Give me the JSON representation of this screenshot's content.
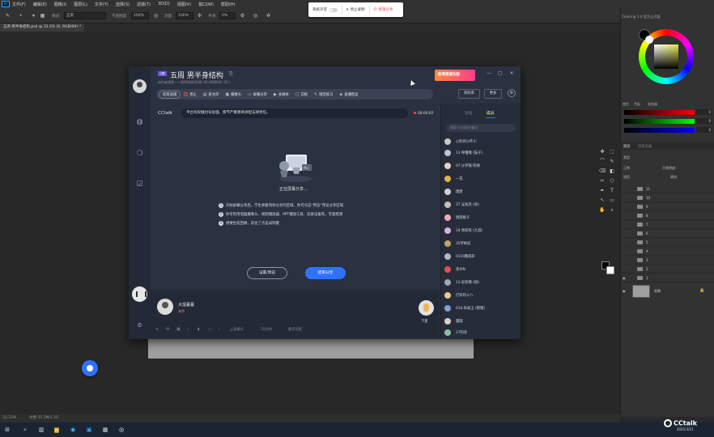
{
  "ps": {
    "menu": [
      "文件(F)",
      "编辑(E)",
      "图像(I)",
      "图层(L)",
      "文字(Y)",
      "选择(S)",
      "滤镜(T)",
      "3D(D)",
      "视图(V)",
      "窗口(W)",
      "帮助(H)"
    ],
    "options": {
      "mode_label": "模式:",
      "mode_value": "正常",
      "opacity_label": "不透明度:",
      "opacity_value": "100%",
      "flow_label": "流量:",
      "flow_value": "100%",
      "smooth_label": "平滑:",
      "smooth_value": "0%"
    },
    "doc_tab": "五周 男半身结构.psd @ 33.3% (6, RGB/8#) *",
    "status_zoom": "33.33%",
    "status_doc": "文档:35.3M/1.2G",
    "color_panel_title": "Coloring 1.4 官方正式版",
    "color_tabs": [
      "颜色",
      "色板",
      "渐变器"
    ],
    "rgb_values": [
      "0",
      "0",
      "0"
    ],
    "layers": {
      "tabs": [
        "图层",
        "历史记录"
      ],
      "kind_label": "类型",
      "mode": "正常",
      "opacity_label": "不透明度:",
      "lock_label": "锁定:",
      "fill_label": "填充:",
      "rows": [
        "11",
        "10",
        "9",
        "8",
        "7",
        "6",
        "5",
        "4",
        "3",
        "2",
        "1"
      ],
      "background": "背景"
    },
    "tools": [
      "✥",
      "⬚",
      "⌒",
      "✎",
      "⌫",
      "◧",
      "✂",
      "⬡",
      "✒",
      "T",
      "↖",
      "▭",
      "✋",
      "⌕"
    ]
  },
  "share_toolbar": {
    "system_sound": "系统声音",
    "pause": "停止录制",
    "end_share": "结束分享"
  },
  "cctalk": {
    "title_badge": "2群",
    "title": "五周 男半身结构",
    "subtitle": "创作者课堂——角色研修员2群 (ID:408836)  35人",
    "promo": "新增直播功能",
    "toolbar": [
      "结束直播",
      "停止",
      "班文库",
      "摄像头",
      "屏幕分享",
      "多媒体",
      "白板",
      "随堂练习",
      "直播售卖"
    ],
    "library": "资料库",
    "more": "更多",
    "brand": "CCtalk",
    "notice": "平台有权做封号处理，情节严重者将承担法律责任。",
    "timer": "00:00:02",
    "sharing_text": "正在屏幕分享...",
    "tips": [
      "开始屏幕分享后，学生将看到你分享的区域，你可点击“预览”预览分享区域",
      "你可利用电脑摄像头、视频播放器、PPT播放工具、双屏设备等，丰富授课",
      "想要生成回顾，前往了点击录制键"
    ],
    "btn_settings": "设置/预览",
    "btn_end_share": "结束分享",
    "right_tabs": [
      "讨论",
      "成员"
    ],
    "member_search": "搜索人员/群名/备注",
    "members": [
      "心叻的小咋小",
      "13 呼噜噜 (猫子)",
      "07-沙罗鼓-陈果",
      "一花",
      "唐唐",
      "37 吴逸尧 (君)",
      "唐薛桃子",
      "34 周梓铭 (九酒)",
      "35罗焕成",
      "0116魏皓轩",
      "叔XIN",
      "12-赵智尊 (桃)",
      "打杂的十八",
      "014-朱家王 (猪猪)",
      "圆圆",
      "27阿亮"
    ],
    "teacher_name": "大溜蔓蔓",
    "teacher_role": "老师",
    "handup": "下麦",
    "bottom_texts": [
      "上麦模式",
      "10分钟",
      "静音设置"
    ]
  },
  "taskbar": {
    "date": "2021/3/21"
  },
  "watermark": "CCtalk"
}
